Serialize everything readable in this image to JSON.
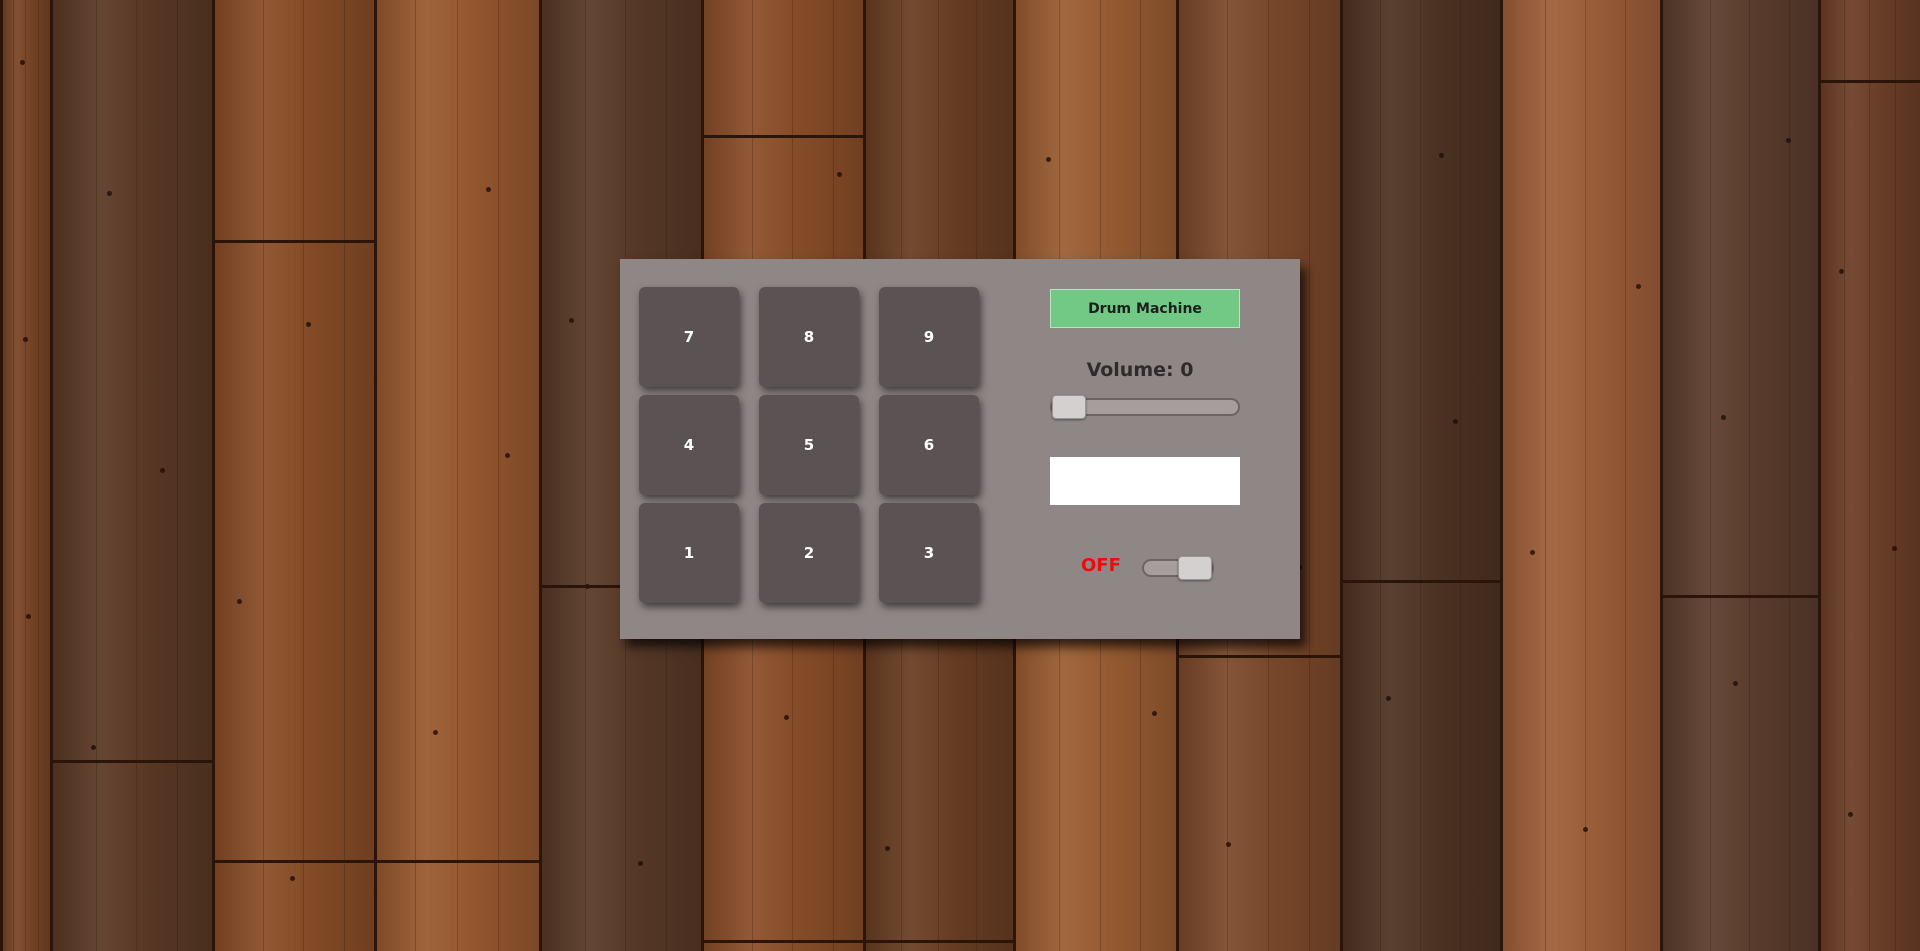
{
  "app": {
    "title": "Drum Machine",
    "display_text": "",
    "accent_color": "#72c985",
    "power_color": "#f00a0a"
  },
  "pads": [
    {
      "label": "7"
    },
    {
      "label": "8"
    },
    {
      "label": "9"
    },
    {
      "label": "4"
    },
    {
      "label": "5"
    },
    {
      "label": "6"
    },
    {
      "label": "1"
    },
    {
      "label": "2"
    },
    {
      "label": "3"
    }
  ],
  "volume": {
    "label": "Volume: 0",
    "value": 0,
    "max": 100
  },
  "power": {
    "label": "OFF",
    "is_on": false
  },
  "background": {
    "theme": "wood-floor",
    "icon": "wood-plank-texture"
  }
}
